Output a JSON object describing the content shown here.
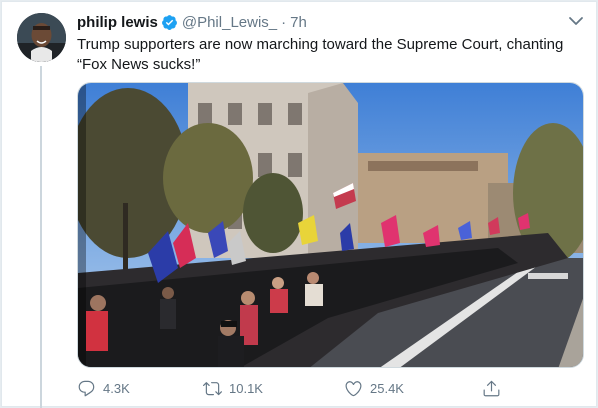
{
  "tweet": {
    "display_name": "philip lewis",
    "handle": "@Phil_Lewis_",
    "separator": "·",
    "time": "7h",
    "text": "Trump supporters are now marching toward the Supreme Court, chanting “Fox News sucks!”",
    "verified_icon": "verified-badge-icon",
    "caret_icon": "chevron-down-icon"
  },
  "actions": {
    "reply_count": "4.3K",
    "retweet_count": "10.1K",
    "like_count": "25.4K",
    "reply_icon": "reply-icon",
    "retweet_icon": "retweet-icon",
    "like_icon": "heart-icon",
    "share_icon": "share-icon"
  },
  "colors": {
    "accent": "#1da1f2",
    "text_primary": "#14171a",
    "text_secondary": "#657786",
    "flag_pink": "#e0336f",
    "flag_blue": "#2b3ca8"
  }
}
